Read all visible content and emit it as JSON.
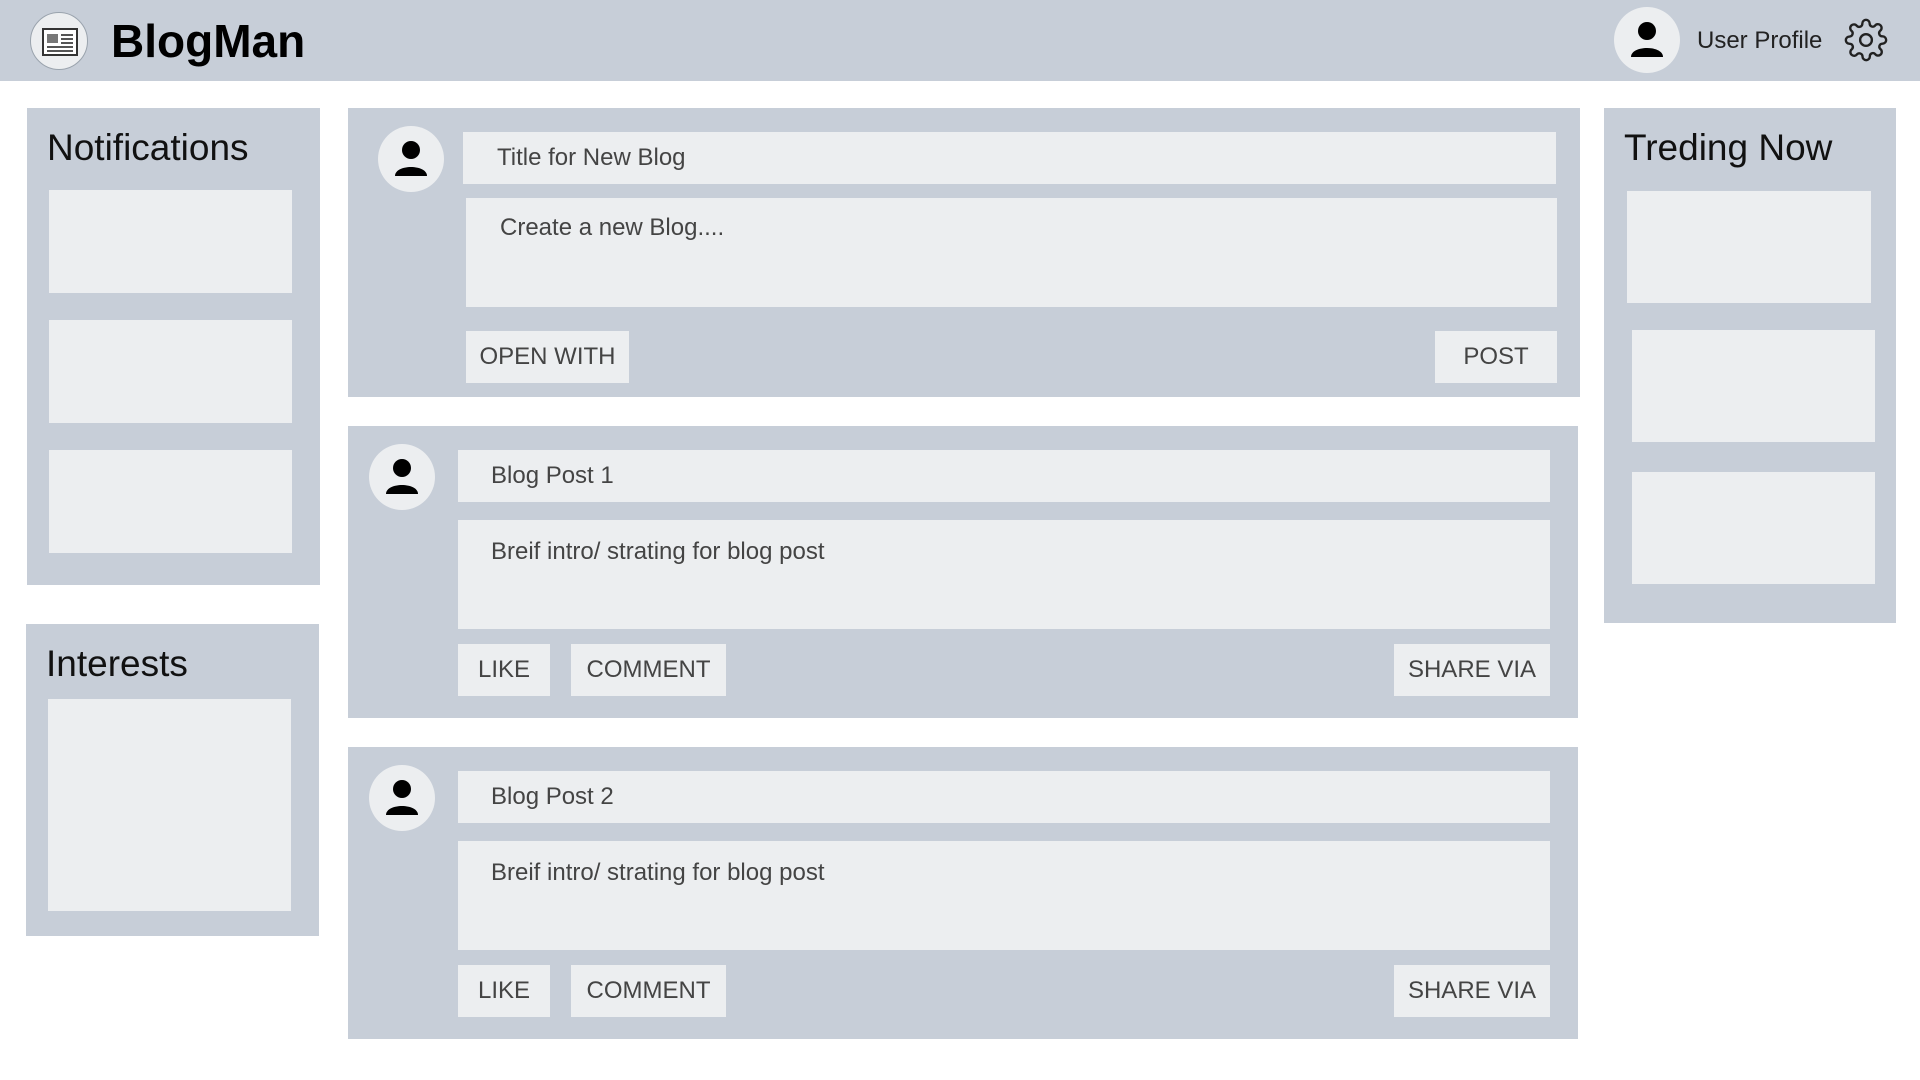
{
  "header": {
    "app_name": "BlogMan",
    "user_profile_label": "User Profile",
    "logo_icon": "newspaper-icon",
    "settings_icon": "gear-icon"
  },
  "notifications": {
    "title": "Notifications"
  },
  "interests": {
    "title": "Interests"
  },
  "trending": {
    "title": "Treding Now"
  },
  "composer": {
    "title_placeholder": "Title for New Blog",
    "body_placeholder": "Create a new Blog....",
    "open_with_label": "OPEN WITH",
    "post_label": "POST"
  },
  "posts": [
    {
      "title": "Blog Post 1",
      "intro": "Breif intro/ strating for blog post",
      "like_label": "LIKE",
      "comment_label": "COMMENT",
      "share_label": "SHARE VIA"
    },
    {
      "title": "Blog Post 2",
      "intro": "Breif intro/ strating for blog post",
      "like_label": "LIKE",
      "comment_label": "COMMENT",
      "share_label": "SHARE VIA"
    }
  ],
  "colors": {
    "panel_bg": "#c7ced8",
    "box_bg": "#eceef0"
  }
}
